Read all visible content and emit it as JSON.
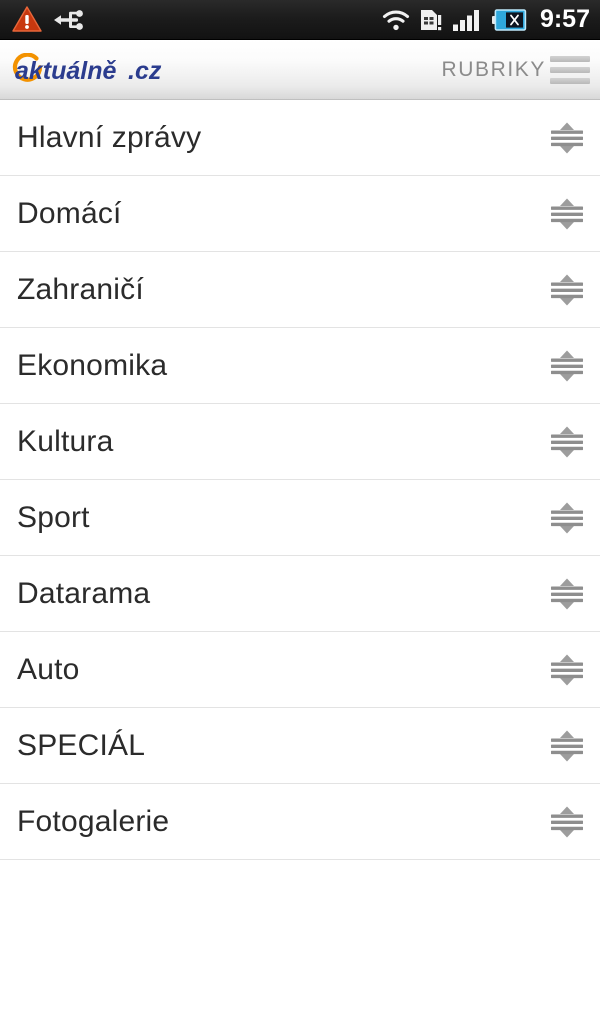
{
  "status_bar": {
    "time": "9:57",
    "left_icons": [
      {
        "name": "warning-triangle-icon",
        "label": "warning"
      },
      {
        "name": "usb-icon",
        "label": "usb connected"
      }
    ],
    "right_icons": [
      {
        "name": "wifi-icon",
        "label": "wifi"
      },
      {
        "name": "sim-card-alert-icon",
        "label": "sim card alert"
      },
      {
        "name": "signal-bars-icon",
        "label": "cellular signal"
      },
      {
        "name": "battery-icon",
        "label": "battery not charging"
      }
    ],
    "colors": {
      "background": "#1c1c1c",
      "text": "#ffffff",
      "warning": "#cc3311",
      "battery": "#29b6e8"
    }
  },
  "header": {
    "logo_text": "aktuálně.cz",
    "logo_brand": "aktuálně",
    "logo_tld": ".cz",
    "menu_label": "RUBRIKY",
    "menu_icon": "hamburger-icon",
    "colors": {
      "logo_blue": "#2b3c8e",
      "logo_orange": "#f39200",
      "menu_text": "#8b8b8b"
    }
  },
  "sections": {
    "items": [
      {
        "label": "Hlavní zprávy",
        "handle_icon": "drag-handle-icon"
      },
      {
        "label": "Domácí",
        "handle_icon": "drag-handle-icon"
      },
      {
        "label": "Zahraničí",
        "handle_icon": "drag-handle-icon"
      },
      {
        "label": "Ekonomika",
        "handle_icon": "drag-handle-icon"
      },
      {
        "label": "Kultura",
        "handle_icon": "drag-handle-icon"
      },
      {
        "label": "Sport",
        "handle_icon": "drag-handle-icon"
      },
      {
        "label": "Datarama",
        "handle_icon": "drag-handle-icon"
      },
      {
        "label": "Auto",
        "handle_icon": "drag-handle-icon"
      },
      {
        "label": "SPECIÁL",
        "handle_icon": "drag-handle-icon"
      },
      {
        "label": "Fotogalerie",
        "handle_icon": "drag-handle-icon"
      }
    ],
    "colors": {
      "text": "#2b2b2b",
      "divider": "#e3e3e3",
      "background": "#ffffff"
    }
  }
}
